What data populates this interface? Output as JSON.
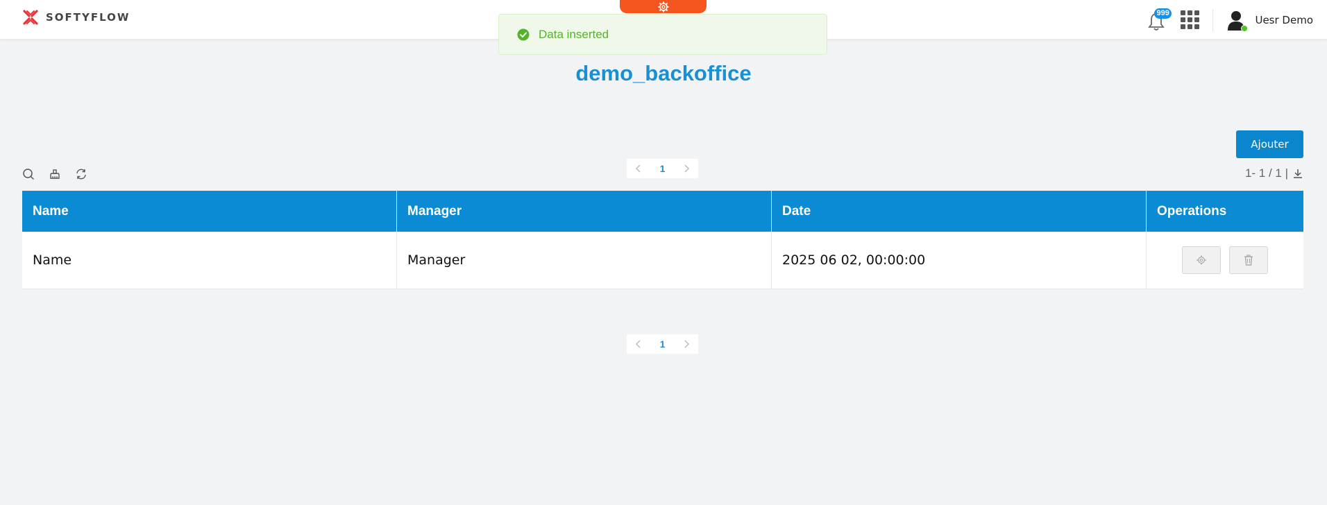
{
  "header": {
    "logo_text": "SOFTYFLOW",
    "notification_count": "999",
    "user_name": "Uesr Demo",
    "accent_color": "#0a8bd4",
    "gear_tab_color": "#f5561f"
  },
  "toast": {
    "message": "Data inserted",
    "icon": "check-circle-icon"
  },
  "page": {
    "title": "demo_backoffice",
    "add_label": "Ajouter",
    "range_info": "1- 1 / 1 |"
  },
  "toolbar": {
    "icons": [
      "search-icon",
      "clear-filter-icon",
      "refresh-icon"
    ]
  },
  "pagination": {
    "current_page": "1"
  },
  "table": {
    "columns": [
      "Name",
      "Manager",
      "Date",
      "Operations"
    ],
    "rows": [
      {
        "name": "Name",
        "manager": "Manager",
        "date": "2025 06 02, 00:00:00"
      }
    ]
  }
}
